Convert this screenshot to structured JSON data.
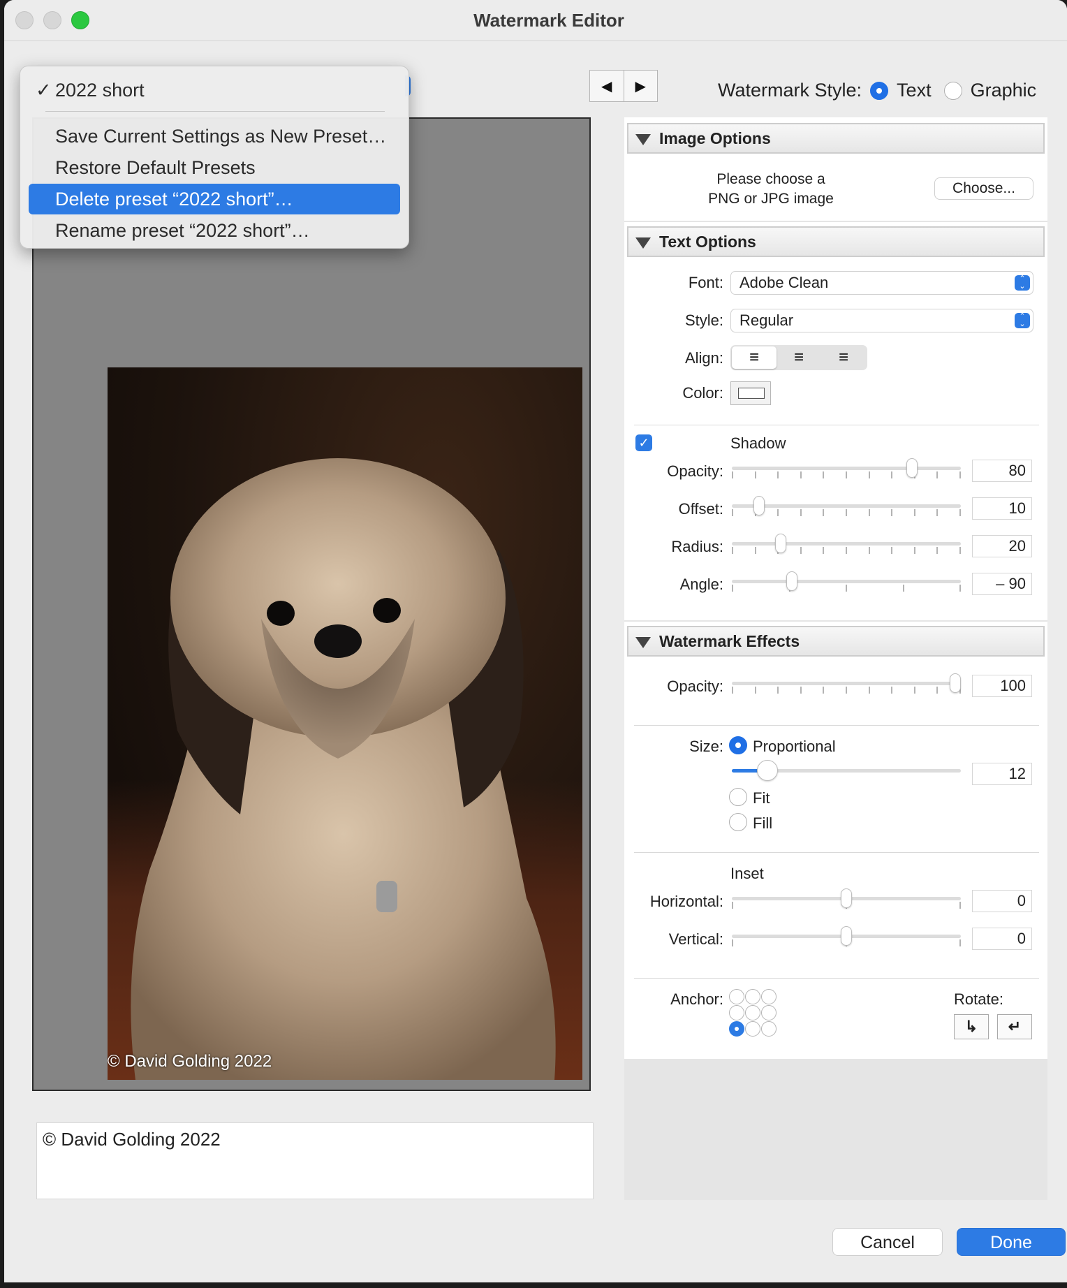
{
  "window": {
    "title": "Watermark Editor"
  },
  "toolbar": {
    "prev_icon": "◀",
    "next_icon": "▶"
  },
  "preset_menu": {
    "current": "2022 short",
    "items": [
      "Save Current Settings as New Preset…",
      "Restore Default Presets",
      "Delete preset “2022 short”…",
      "Rename preset “2022 short”…"
    ],
    "highlighted_index": 2
  },
  "watermark_style": {
    "label": "Watermark Style:",
    "options": [
      "Text",
      "Graphic"
    ],
    "selected": "Text"
  },
  "preview": {
    "overlay_text": "© David Golding 2022"
  },
  "text_entry": {
    "value": "© David Golding 2022"
  },
  "image_options": {
    "title": "Image Options",
    "prompt_line1": "Please choose a",
    "prompt_line2": "PNG or JPG image",
    "choose_label": "Choose..."
  },
  "text_options": {
    "title": "Text Options",
    "font_label": "Font:",
    "font_value": "Adobe Clean",
    "style_label": "Style:",
    "style_value": "Regular",
    "align_label": "Align:",
    "align_selected": "left",
    "color_label": "Color:",
    "shadow": {
      "label": "Shadow",
      "enabled": true,
      "opacity_label": "Opacity:",
      "opacity": "80",
      "offset_label": "Offset:",
      "offset": "10",
      "radius_label": "Radius:",
      "radius": "20",
      "angle_label": "Angle:",
      "angle": "– 90"
    }
  },
  "watermark_effects": {
    "title": "Watermark Effects",
    "opacity_label": "Opacity:",
    "opacity": "100",
    "size_label": "Size:",
    "size_options": [
      "Proportional",
      "Fit",
      "Fill"
    ],
    "size_selected": "Proportional",
    "size_value": "12",
    "inset_label": "Inset",
    "horizontal_label": "Horizontal:",
    "horizontal": "0",
    "vertical_label": "Vertical:",
    "vertical": "0",
    "anchor_label": "Anchor:",
    "anchor_selected": "bottom-left",
    "rotate_label": "Rotate:"
  },
  "footer": {
    "cancel_label": "Cancel",
    "done_label": "Done"
  },
  "colors": {
    "accent": "#2d7be4"
  }
}
